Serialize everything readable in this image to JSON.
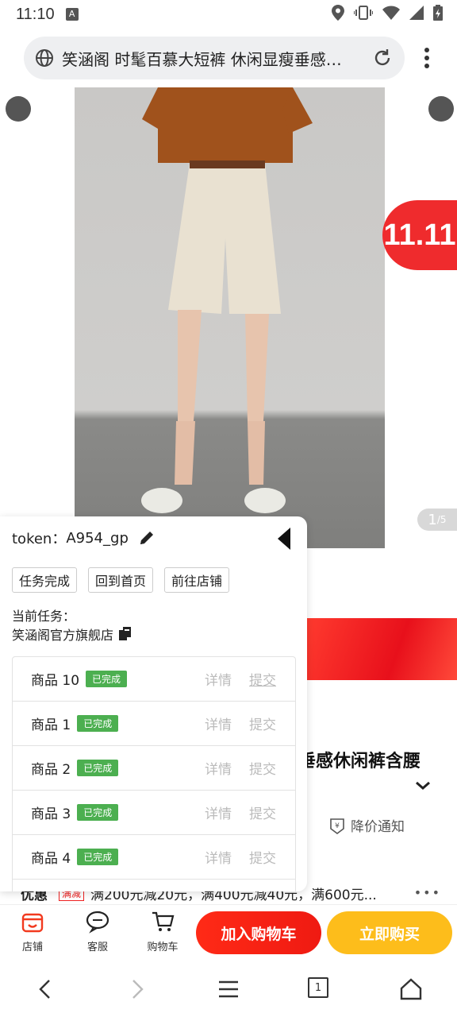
{
  "status_bar": {
    "time": "11:10",
    "notification_icon": "A"
  },
  "browser": {
    "page_title": "笑涵阁 时髦百慕大短裤 休闲显瘦垂感…"
  },
  "product": {
    "promo_badge": "11.11",
    "page_current": "1",
    "page_total": "/5",
    "title_tail": "垂感休闲裤含腰",
    "price_alert": "降价通知",
    "coupon_label": "优惠",
    "coupon_tag": "满减",
    "coupon_text": "满200元减20元，满400元减40元，满600元..."
  },
  "panel": {
    "token_label": "token：",
    "token_value": "A954_gp",
    "buttons": [
      "任务完成",
      "回到首页",
      "前往店铺"
    ],
    "task_label": "当前任务：",
    "task_name": "笑涵阁官方旗舰店",
    "items": [
      {
        "name": "商品 10",
        "status": "已完成",
        "detail": "详情",
        "submit": "提交"
      },
      {
        "name": "商品 1",
        "status": "已完成",
        "detail": "详情",
        "submit": "提交"
      },
      {
        "name": "商品 2",
        "status": "已完成",
        "detail": "详情",
        "submit": "提交"
      },
      {
        "name": "商品 3",
        "status": "已完成",
        "detail": "详情",
        "submit": "提交"
      },
      {
        "name": "商品 4",
        "status": "已完成",
        "detail": "详情",
        "submit": "提交"
      }
    ]
  },
  "action_bar": {
    "shop": "店铺",
    "service": "客服",
    "cart": "购物车",
    "add_to_cart": "加入购物车",
    "buy_now": "立即购买"
  },
  "nav": {
    "tab_count": "1"
  }
}
